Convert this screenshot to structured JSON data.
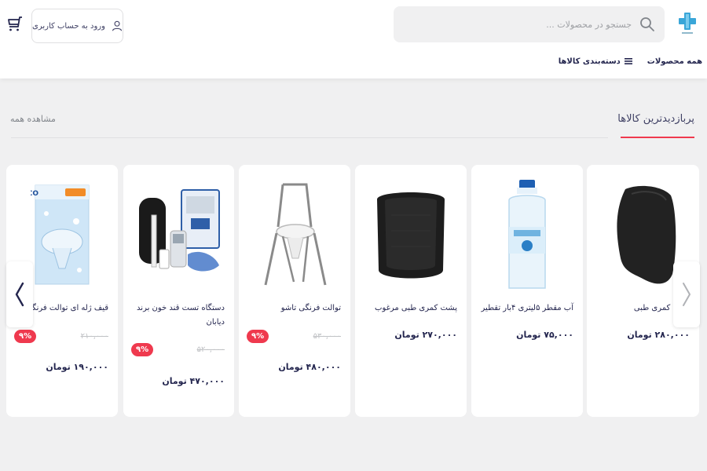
{
  "header": {
    "search": {
      "placeholder": "جستجو در محصولات ..."
    },
    "login_label": "ورود به حساب کاربری",
    "nav": [
      {
        "label": "دسته‌بندی کالاها",
        "icon": "menu-icon"
      },
      {
        "label": "همه محصولات"
      }
    ]
  },
  "section": {
    "title": "پربازدیدترین کالاها",
    "see_all": "مشاهده همه"
  },
  "colors": {
    "accent": "#ef394e",
    "text": "#23254e",
    "background": "#f0f0f1"
  },
  "products": [
    {
      "title": "پشت کمری طبی",
      "price": "۲۸۰,۰۰۰ تومان"
    },
    {
      "title": "آب مقطر ۵لیتری ۴بار تقطیر",
      "price": "۷۵,۰۰۰ تومان"
    },
    {
      "title": "پشت کمری طبی مرغوب",
      "price": "۲۷۰,۰۰۰ تومان"
    },
    {
      "title": "توالت فرنگی تاشو",
      "old_price": "۵۳۰,۰۰۰",
      "discount": "۹%",
      "price": "۴۸۰,۰۰۰ تومان"
    },
    {
      "title": "دستگاه تست قند خون برند دیابان",
      "old_price": "۵۲۰,۰۰۰",
      "discount": "۹%",
      "price": "۴۷۰,۰۰۰ تومان"
    },
    {
      "title": "قیف ژله ای توالت فرنگی",
      "old_price": "۲۱۰,۰۰۰",
      "discount": "۹%",
      "price": "۱۹۰,۰۰۰ تومان",
      "brand_text": "SINCO"
    }
  ]
}
